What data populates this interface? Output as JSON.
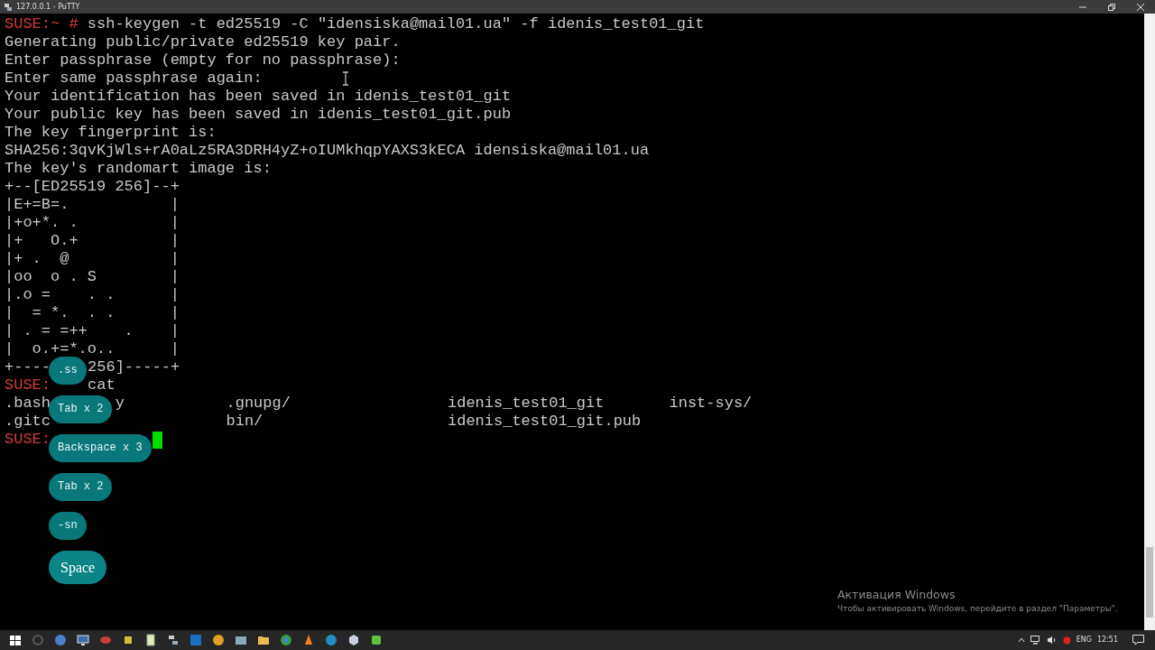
{
  "window": {
    "title": "127.0.0.1 - PuTTY"
  },
  "terminal": {
    "lines": [
      {
        "kind": "prompt",
        "prompt": "SUSE:~ #",
        "command": "ssh-keygen -t ed25519 -C \"idensiska@mail01.ua\" -f idenis_test01_git"
      },
      {
        "kind": "output",
        "parts": [
          "Generating public/private ed25519 key pair."
        ]
      },
      {
        "kind": "output",
        "parts": [
          "Enter passphrase (empty for no passphrase):"
        ]
      },
      {
        "kind": "output",
        "parts": [
          "Enter same passphrase again:"
        ]
      },
      {
        "kind": "output",
        "parts": [
          "Your identification has been saved in idenis_test01_git"
        ]
      },
      {
        "kind": "output",
        "parts": [
          "Your public key has been saved in idenis_test01_git.pub"
        ]
      },
      {
        "kind": "output",
        "parts": [
          "The key fingerprint is:"
        ]
      },
      {
        "kind": "output",
        "parts": [
          "SHA256:3qvKjWls+rA0aLz5RA3DRH4yZ+oIUMkhqpYAXS3kECA idensiska@mail01.ua"
        ]
      },
      {
        "kind": "output",
        "parts": [
          "The key's randomart image is:"
        ]
      },
      {
        "kind": "output",
        "parts": [
          "+--[ED25519 256]--+"
        ]
      },
      {
        "kind": "output",
        "parts": [
          "|E+=B=.           |"
        ]
      },
      {
        "kind": "output",
        "parts": [
          "|+o+*. .          |"
        ]
      },
      {
        "kind": "output",
        "parts": [
          "|+   O.+          |"
        ]
      },
      {
        "kind": "output",
        "parts": [
          "|+ .  @           |"
        ]
      },
      {
        "kind": "output",
        "parts": [
          "|oo  o . S        |"
        ]
      },
      {
        "kind": "output",
        "parts": [
          "|.o =    . .      |"
        ]
      },
      {
        "kind": "output",
        "parts": [
          "|  = *.  . .      |"
        ]
      },
      {
        "kind": "output",
        "parts": [
          "| . = =++    .    |"
        ]
      },
      {
        "kind": "output",
        "parts": [
          "|  o.+=*.o..      |"
        ]
      },
      {
        "kind": "output",
        "parts": [
          "+----",
          "256]-----+"
        ]
      },
      {
        "kind": "prompt",
        "prompt": "SUSE:",
        "command": "cat"
      },
      {
        "kind": "columns",
        "cells": [
          [
            ".bash",
            "y"
          ],
          [
            ".gnupg/"
          ],
          [
            "idenis_test01_git"
          ],
          [
            "inst-sys/"
          ]
        ]
      },
      {
        "kind": "columns",
        "cells": [
          [
            ".gitc"
          ],
          [
            "bin/"
          ],
          [
            "idenis_test01_git.pub"
          ]
        ]
      },
      {
        "kind": "prompt",
        "prompt": "SUSE:",
        "cursor": true
      }
    ]
  },
  "keystrokes": [
    {
      "label": ".ss",
      "latest": false
    },
    {
      "label": "Tab x 2",
      "latest": false
    },
    {
      "label": "Backspace x 3",
      "latest": false
    },
    {
      "label": "Tab x 2",
      "latest": false
    },
    {
      "label": "-sn",
      "latest": false
    },
    {
      "label": "Space",
      "latest": true
    }
  ],
  "activation_notice": {
    "title": "Активация Windows",
    "text": "Чтобы активировать Windows, перейдите в раздел \"Параметры\"."
  },
  "taskbar": {
    "language": "ENG",
    "time": "12:51"
  }
}
